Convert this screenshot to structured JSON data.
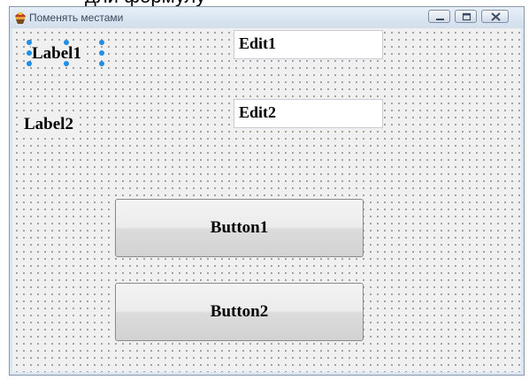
{
  "page": {
    "cutoff_text": "дли формулу"
  },
  "window": {
    "title": "Поменять местами",
    "icon": "app-icon",
    "controls": [
      "minimize-icon",
      "maximize-icon",
      "close-icon"
    ]
  },
  "form": {
    "label1": "Label1",
    "label2": "Label2",
    "edit1": "Edit1",
    "edit2": "Edit2",
    "button1": "Button1",
    "button2": "Button2",
    "selected_component": "Label1"
  },
  "colors": {
    "selection_handle": "#1e8ee6",
    "form_background": "#f0f0f0",
    "title_text": "#3b4a5e"
  }
}
